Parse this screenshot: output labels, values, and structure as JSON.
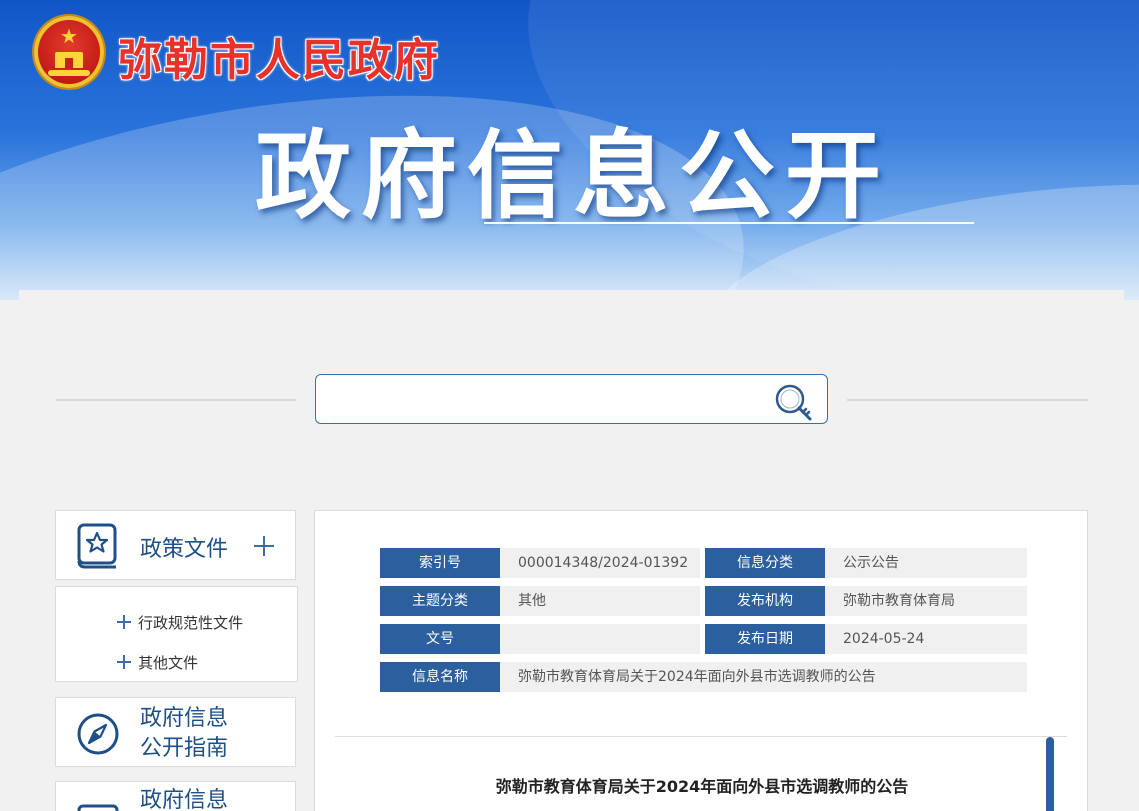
{
  "header": {
    "site_name": "弥勒市人民政府",
    "banner_title": "政府信息公开"
  },
  "search": {
    "value": "",
    "placeholder": ""
  },
  "sidebar": {
    "policy_files": {
      "label": "政策文件",
      "icon": "star-book-icon",
      "children": [
        "行政规范性文件",
        "其他文件"
      ]
    },
    "guide": {
      "label_line1": "政府信息",
      "label_line2": "公开指南",
      "icon": "compass-icon"
    },
    "more": {
      "label_line1": "政府信息",
      "icon": "document-stack-icon"
    }
  },
  "meta": {
    "index_no": {
      "label": "索引号",
      "value": "000014348/2024-01392"
    },
    "info_category": {
      "label": "信息分类",
      "value": "公示公告"
    },
    "topic_category": {
      "label": "主题分类",
      "value": "其他"
    },
    "publisher": {
      "label": "发布机构",
      "value": "弥勒市教育体育局"
    },
    "doc_no": {
      "label": "文号",
      "value": ""
    },
    "publish_date": {
      "label": "发布日期",
      "value": "2024-05-24"
    },
    "info_name": {
      "label": "信息名称",
      "value": "弥勒市教育体育局关于2024年面向外县市选调教师的公告"
    }
  },
  "article": {
    "title": "弥勒市教育体育局关于2024年面向外县市选调教师的公告"
  },
  "colors": {
    "brand_blue": "#2c5f9e",
    "site_name_red": "#e8312a",
    "accent_blue": "#3d6ea5"
  }
}
